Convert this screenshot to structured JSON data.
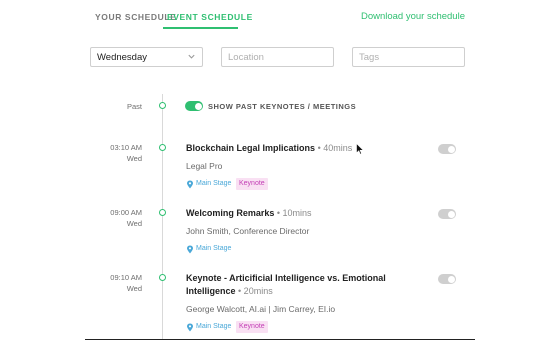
{
  "tabs": {
    "your_schedule": "YOUR SCHEDULE",
    "event_schedule": "EVENT SCHEDULE",
    "download": "Download your schedule"
  },
  "filters": {
    "day_value": "Wednesday",
    "location_placeholder": "Location",
    "tags_placeholder": "Tags"
  },
  "past": {
    "label": "Past",
    "toggle_label": "SHOW PAST KEYNOTES / MEETINGS",
    "toggle_on": true
  },
  "events": [
    {
      "time": "03:10 AM",
      "day": "Wed",
      "title": "Blockchain Legal Implications",
      "duration": "• 40mins",
      "speaker": "Legal Pro",
      "stage": "Main Stage",
      "tag": "Keynote",
      "toggle_on": false
    },
    {
      "time": "09:00 AM",
      "day": "Wed",
      "title": "Welcoming Remarks",
      "duration": "• 10mins",
      "speaker": "John Smith, Conference Director",
      "stage": "Main Stage",
      "tag": "",
      "toggle_on": false
    },
    {
      "time": "09:10 AM",
      "day": "Wed",
      "title": "Keynote - Articificial Intelligence vs. Emotional Intelligence",
      "duration": "• 20mins",
      "speaker": "George Walcott, AI.ai | Jim Carrey, EI.io",
      "stage": "Main Stage",
      "tag": "Keynote",
      "toggle_on": false
    }
  ],
  "colors": {
    "accent": "#2fbf71",
    "stage_text": "#4aa8d8",
    "tag_text": "#c33eb5",
    "tag_bg": "#f9e0f3",
    "toggle_off": "#cfcfcf"
  },
  "icons": {
    "dropdown": "chevron-down-icon",
    "location": "map-pin-icon",
    "pointer": "mouse-cursor-icon"
  }
}
